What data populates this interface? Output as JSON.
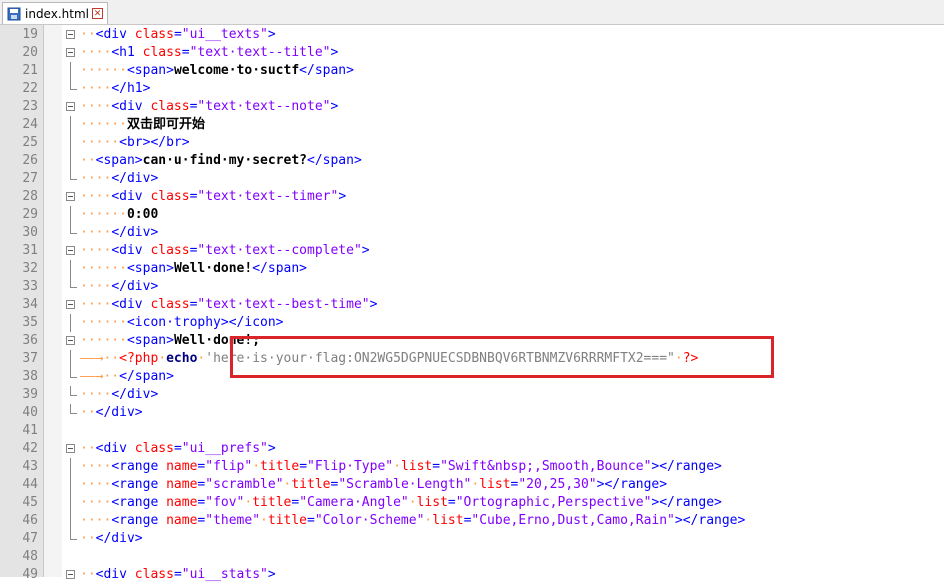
{
  "tab": {
    "label": "index.html",
    "icon": "file-save-icon",
    "close_icon": "close-icon"
  },
  "colors": {
    "highlight_box": "#d9252a",
    "tag": "#0000ff",
    "attr": "#ff0000",
    "string": "#8000ff",
    "whitespace": "#ff9a45"
  },
  "lines": [
    {
      "n": "19",
      "fold": "box",
      "segs": [
        [
          "ws",
          "··"
        ],
        [
          "tag",
          "<div "
        ],
        [
          "attr",
          "class"
        ],
        [
          "tag",
          "="
        ],
        [
          "str",
          "\"ui__texts\""
        ],
        [
          "tag",
          ">"
        ]
      ]
    },
    {
      "n": "20",
      "fold": "box",
      "segs": [
        [
          "ws",
          "····"
        ],
        [
          "tag",
          "<h1 "
        ],
        [
          "attr",
          "class"
        ],
        [
          "tag",
          "="
        ],
        [
          "str",
          "\"text·text--title\""
        ],
        [
          "tag",
          ">"
        ]
      ]
    },
    {
      "n": "21",
      "fold": "line",
      "segs": [
        [
          "ws",
          "······"
        ],
        [
          "tag",
          "<span>"
        ],
        [
          "txt",
          "welcome·to·suctf"
        ],
        [
          "tag",
          "</span>"
        ]
      ]
    },
    {
      "n": "22",
      "fold": "end",
      "segs": [
        [
          "ws",
          "····"
        ],
        [
          "tag",
          "</h1>"
        ]
      ]
    },
    {
      "n": "23",
      "fold": "box",
      "segs": [
        [
          "ws",
          "····"
        ],
        [
          "tag",
          "<div "
        ],
        [
          "attr",
          "class"
        ],
        [
          "tag",
          "="
        ],
        [
          "str",
          "\"text·text--note\""
        ],
        [
          "tag",
          ">"
        ]
      ]
    },
    {
      "n": "24",
      "fold": "line",
      "segs": [
        [
          "ws",
          "······"
        ],
        [
          "txt",
          "双击即可开始"
        ]
      ]
    },
    {
      "n": "25",
      "fold": "line",
      "segs": [
        [
          "ws",
          "·····"
        ],
        [
          "tag",
          "<br></br>"
        ]
      ]
    },
    {
      "n": "26",
      "fold": "line",
      "segs": [
        [
          "ws",
          "··"
        ],
        [
          "tag",
          "<span>"
        ],
        [
          "txt",
          "can·u·find·my·secret?"
        ],
        [
          "tag",
          "</span>"
        ]
      ]
    },
    {
      "n": "27",
      "fold": "end",
      "segs": [
        [
          "ws",
          "····"
        ],
        [
          "tag",
          "</div>"
        ]
      ]
    },
    {
      "n": "28",
      "fold": "box",
      "segs": [
        [
          "ws",
          "····"
        ],
        [
          "tag",
          "<div "
        ],
        [
          "attr",
          "class"
        ],
        [
          "tag",
          "="
        ],
        [
          "str",
          "\"text·text--timer\""
        ],
        [
          "tag",
          ">"
        ]
      ]
    },
    {
      "n": "29",
      "fold": "line",
      "segs": [
        [
          "ws",
          "······"
        ],
        [
          "txt",
          "0:00"
        ]
      ]
    },
    {
      "n": "30",
      "fold": "end",
      "segs": [
        [
          "ws",
          "····"
        ],
        [
          "tag",
          "</div>"
        ]
      ]
    },
    {
      "n": "31",
      "fold": "box",
      "segs": [
        [
          "ws",
          "····"
        ],
        [
          "tag",
          "<div "
        ],
        [
          "attr",
          "class"
        ],
        [
          "tag",
          "="
        ],
        [
          "str",
          "\"text·text--complete\""
        ],
        [
          "tag",
          ">"
        ]
      ]
    },
    {
      "n": "32",
      "fold": "line",
      "segs": [
        [
          "ws",
          "······"
        ],
        [
          "tag",
          "<span>"
        ],
        [
          "txt",
          "Well·done!"
        ],
        [
          "tag",
          "</span>"
        ]
      ]
    },
    {
      "n": "33",
      "fold": "end",
      "segs": [
        [
          "ws",
          "····"
        ],
        [
          "tag",
          "</div>"
        ]
      ]
    },
    {
      "n": "34",
      "fold": "box",
      "segs": [
        [
          "ws",
          "····"
        ],
        [
          "tag",
          "<div "
        ],
        [
          "attr",
          "class"
        ],
        [
          "tag",
          "="
        ],
        [
          "str",
          "\"text·text--best-time\""
        ],
        [
          "tag",
          ">"
        ]
      ]
    },
    {
      "n": "35",
      "fold": "line",
      "segs": [
        [
          "ws",
          "······"
        ],
        [
          "tag",
          "<icon·trophy></icon>"
        ]
      ]
    },
    {
      "n": "36",
      "fold": "box",
      "segs": [
        [
          "ws",
          "······"
        ],
        [
          "tag",
          "<span>"
        ],
        [
          "txt",
          "Well·done!;"
        ]
      ]
    },
    {
      "n": "37",
      "fold": "line",
      "segs": [
        [
          "arrow",
          "——→··"
        ],
        [
          "php-delim",
          "<?php"
        ],
        [
          "ws",
          "·"
        ],
        [
          "php-kw",
          "echo"
        ],
        [
          "ws",
          "·"
        ],
        [
          "php-str",
          "'here·is·your·flag:ON2WG5DGPNUECSDBNBQV6RTBNMZV6RRRMFTX2===\""
        ],
        [
          "ws",
          "·"
        ],
        [
          "php-delim",
          "?>"
        ]
      ]
    },
    {
      "n": "38",
      "fold": "end",
      "segs": [
        [
          "arrow",
          "——→··"
        ],
        [
          "tag",
          "</span>"
        ]
      ]
    },
    {
      "n": "39",
      "fold": "end",
      "segs": [
        [
          "ws",
          "····"
        ],
        [
          "tag",
          "</div>"
        ]
      ]
    },
    {
      "n": "40",
      "fold": "end",
      "segs": [
        [
          "ws",
          "··"
        ],
        [
          "tag",
          "</div>"
        ]
      ]
    },
    {
      "n": "41",
      "fold": "none",
      "segs": []
    },
    {
      "n": "42",
      "fold": "box",
      "segs": [
        [
          "ws",
          "··"
        ],
        [
          "tag",
          "<div "
        ],
        [
          "attr",
          "class"
        ],
        [
          "tag",
          "="
        ],
        [
          "str",
          "\"ui__prefs\""
        ],
        [
          "tag",
          ">"
        ]
      ]
    },
    {
      "n": "43",
      "fold": "line",
      "segs": [
        [
          "ws",
          "····"
        ],
        [
          "tag",
          "<range "
        ],
        [
          "attr",
          "name"
        ],
        [
          "tag",
          "="
        ],
        [
          "str",
          "\"flip\""
        ],
        [
          "ws",
          "·"
        ],
        [
          "attr",
          "title"
        ],
        [
          "tag",
          "="
        ],
        [
          "str",
          "\"Flip·Type\""
        ],
        [
          "ws",
          "·"
        ],
        [
          "attr",
          "list"
        ],
        [
          "tag",
          "="
        ],
        [
          "str",
          "\"Swift&nbsp;,Smooth,Bounce\""
        ],
        [
          "tag",
          "></range>"
        ]
      ]
    },
    {
      "n": "44",
      "fold": "line",
      "segs": [
        [
          "ws",
          "····"
        ],
        [
          "tag",
          "<range "
        ],
        [
          "attr",
          "name"
        ],
        [
          "tag",
          "="
        ],
        [
          "str",
          "\"scramble\""
        ],
        [
          "ws",
          "·"
        ],
        [
          "attr",
          "title"
        ],
        [
          "tag",
          "="
        ],
        [
          "str",
          "\"Scramble·Length\""
        ],
        [
          "ws",
          "·"
        ],
        [
          "attr",
          "list"
        ],
        [
          "tag",
          "="
        ],
        [
          "str",
          "\"20,25,30\""
        ],
        [
          "tag",
          "></range>"
        ]
      ]
    },
    {
      "n": "45",
      "fold": "line",
      "segs": [
        [
          "ws",
          "····"
        ],
        [
          "tag",
          "<range "
        ],
        [
          "attr",
          "name"
        ],
        [
          "tag",
          "="
        ],
        [
          "str",
          "\"fov\""
        ],
        [
          "ws",
          "·"
        ],
        [
          "attr",
          "title"
        ],
        [
          "tag",
          "="
        ],
        [
          "str",
          "\"Camera·Angle\""
        ],
        [
          "ws",
          "·"
        ],
        [
          "attr",
          "list"
        ],
        [
          "tag",
          "="
        ],
        [
          "str",
          "\"Ortographic,Perspective\""
        ],
        [
          "tag",
          "></range>"
        ]
      ]
    },
    {
      "n": "46",
      "fold": "line",
      "segs": [
        [
          "ws",
          "····"
        ],
        [
          "tag",
          "<range "
        ],
        [
          "attr",
          "name"
        ],
        [
          "tag",
          "="
        ],
        [
          "str",
          "\"theme\""
        ],
        [
          "ws",
          "·"
        ],
        [
          "attr",
          "title"
        ],
        [
          "tag",
          "="
        ],
        [
          "str",
          "\"Color·Scheme\""
        ],
        [
          "ws",
          "·"
        ],
        [
          "attr",
          "list"
        ],
        [
          "tag",
          "="
        ],
        [
          "str",
          "\"Cube,Erno,Dust,Camo,Rain\""
        ],
        [
          "tag",
          "></range>"
        ]
      ]
    },
    {
      "n": "47",
      "fold": "end",
      "segs": [
        [
          "ws",
          "··"
        ],
        [
          "tag",
          "</div>"
        ]
      ]
    },
    {
      "n": "48",
      "fold": "none",
      "segs": []
    },
    {
      "n": "49",
      "fold": "box",
      "segs": [
        [
          "ws",
          "··"
        ],
        [
          "tag",
          "<div "
        ],
        [
          "attr",
          "class"
        ],
        [
          "tag",
          "="
        ],
        [
          "str",
          "\"ui__stats\""
        ],
        [
          "tag",
          ">"
        ]
      ]
    }
  ]
}
